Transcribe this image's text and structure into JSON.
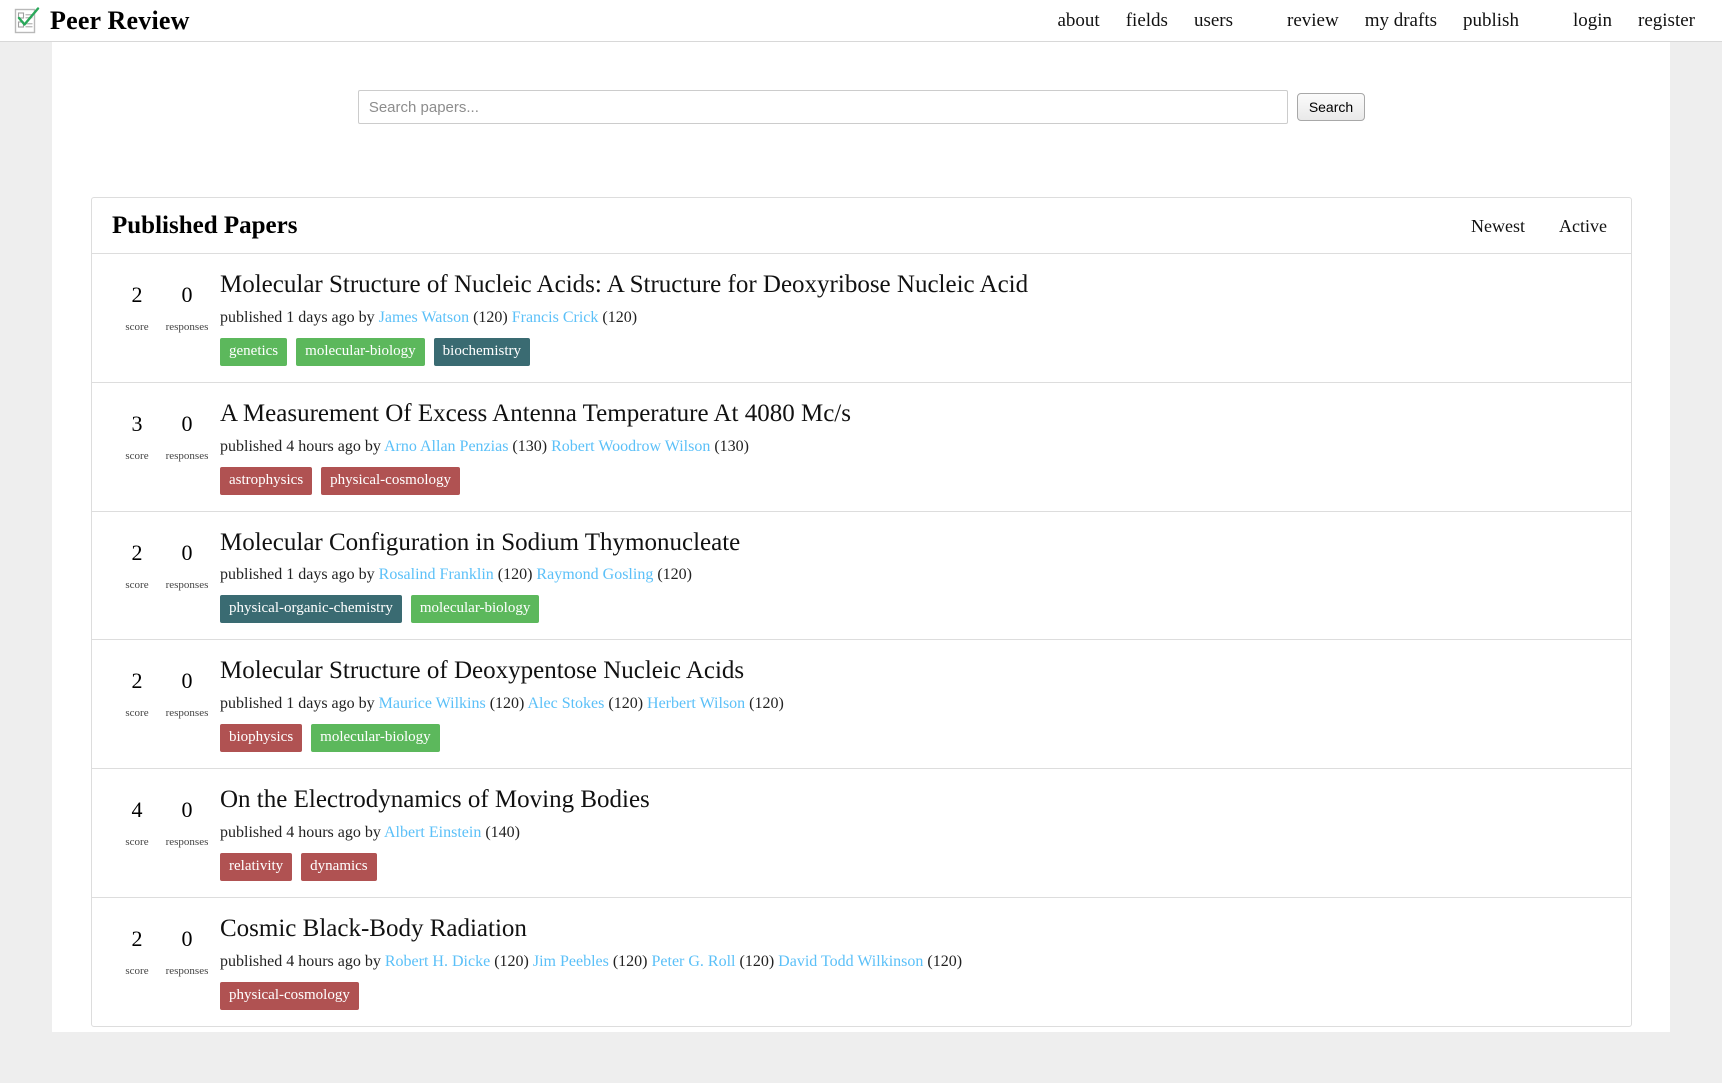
{
  "site": {
    "brand": "Peer Review",
    "logo_icon": "checklist-check-icon"
  },
  "nav": {
    "groups": [
      {
        "items": [
          {
            "label": "about",
            "name": "nav-link-about"
          },
          {
            "label": "fields",
            "name": "nav-link-fields"
          },
          {
            "label": "users",
            "name": "nav-link-users"
          }
        ]
      },
      {
        "items": [
          {
            "label": "review",
            "name": "nav-link-review"
          },
          {
            "label": "my drafts",
            "name": "nav-link-my-drafts"
          },
          {
            "label": "publish",
            "name": "nav-link-publish"
          }
        ]
      },
      {
        "items": [
          {
            "label": "login",
            "name": "nav-link-login"
          },
          {
            "label": "register",
            "name": "nav-link-register"
          }
        ]
      }
    ]
  },
  "search": {
    "placeholder": "Search papers...",
    "value": "",
    "button_label": "Search"
  },
  "panel": {
    "title": "Published Papers",
    "sorts": [
      {
        "label": "Newest",
        "name": "sort-newest"
      },
      {
        "label": "Active",
        "name": "sort-active"
      }
    ]
  },
  "colors": {
    "tag_green": "#5cb85c",
    "tag_teal": "#3a6b72",
    "tag_red": "#b05252",
    "author_link": "#5bc0f8",
    "page_bg": "#eeeeee",
    "border": "#dddddd"
  },
  "labels": {
    "score": "score",
    "responses": "responses",
    "published_prefix": "published",
    "by": "by"
  },
  "papers": [
    {
      "score": "2",
      "responses": "0",
      "title": "Molecular Structure of Nucleic Acids: A Structure for Deoxyribose Nucleic Acid",
      "meta_prefix": "published 1 days ago by",
      "authors": [
        {
          "name": "James Watson",
          "reputation": "(120)"
        },
        {
          "name": "Francis Crick",
          "reputation": "(120)"
        }
      ],
      "tags": [
        {
          "label": "genetics",
          "color": "#5cb85c"
        },
        {
          "label": "molecular-biology",
          "color": "#5cb85c"
        },
        {
          "label": "biochemistry",
          "color": "#3a6b72"
        }
      ]
    },
    {
      "score": "3",
      "responses": "0",
      "title": "A Measurement Of Excess Antenna Temperature At 4080 Mc/s",
      "meta_prefix": "published 4 hours ago by",
      "authors": [
        {
          "name": "Arno Allan Penzias",
          "reputation": "(130)"
        },
        {
          "name": "Robert Woodrow Wilson",
          "reputation": "(130)"
        }
      ],
      "tags": [
        {
          "label": "astrophysics",
          "color": "#b05252"
        },
        {
          "label": "physical-cosmology",
          "color": "#b05252"
        }
      ]
    },
    {
      "score": "2",
      "responses": "0",
      "title": "Molecular Configuration in Sodium Thymonucleate",
      "meta_prefix": "published 1 days ago by",
      "authors": [
        {
          "name": "Rosalind Franklin",
          "reputation": "(120)"
        },
        {
          "name": "Raymond Gosling",
          "reputation": "(120)"
        }
      ],
      "tags": [
        {
          "label": "physical-organic-chemistry",
          "color": "#3a6b72"
        },
        {
          "label": "molecular-biology",
          "color": "#5cb85c"
        }
      ]
    },
    {
      "score": "2",
      "responses": "0",
      "title": "Molecular Structure of Deoxypentose Nucleic Acids",
      "meta_prefix": "published 1 days ago by",
      "authors": [
        {
          "name": "Maurice Wilkins",
          "reputation": "(120)"
        },
        {
          "name": "Alec Stokes",
          "reputation": "(120)"
        },
        {
          "name": "Herbert Wilson",
          "reputation": "(120)"
        }
      ],
      "tags": [
        {
          "label": "biophysics",
          "color": "#b05252"
        },
        {
          "label": "molecular-biology",
          "color": "#5cb85c"
        }
      ]
    },
    {
      "score": "4",
      "responses": "0",
      "title": "On the Electrodynamics of Moving Bodies",
      "meta_prefix": "published 4 hours ago by",
      "authors": [
        {
          "name": "Albert Einstein",
          "reputation": "(140)"
        }
      ],
      "tags": [
        {
          "label": "relativity",
          "color": "#b05252"
        },
        {
          "label": "dynamics",
          "color": "#b05252"
        }
      ]
    },
    {
      "score": "2",
      "responses": "0",
      "title": "Cosmic Black-Body Radiation",
      "meta_prefix": "published 4 hours ago by",
      "authors": [
        {
          "name": "Robert H. Dicke",
          "reputation": "(120)"
        },
        {
          "name": "Jim Peebles",
          "reputation": "(120)"
        },
        {
          "name": "Peter G. Roll",
          "reputation": "(120)"
        },
        {
          "name": "David Todd Wilkinson",
          "reputation": "(120)"
        }
      ],
      "tags": [
        {
          "label": "physical-cosmology",
          "color": "#b05252"
        }
      ]
    }
  ]
}
